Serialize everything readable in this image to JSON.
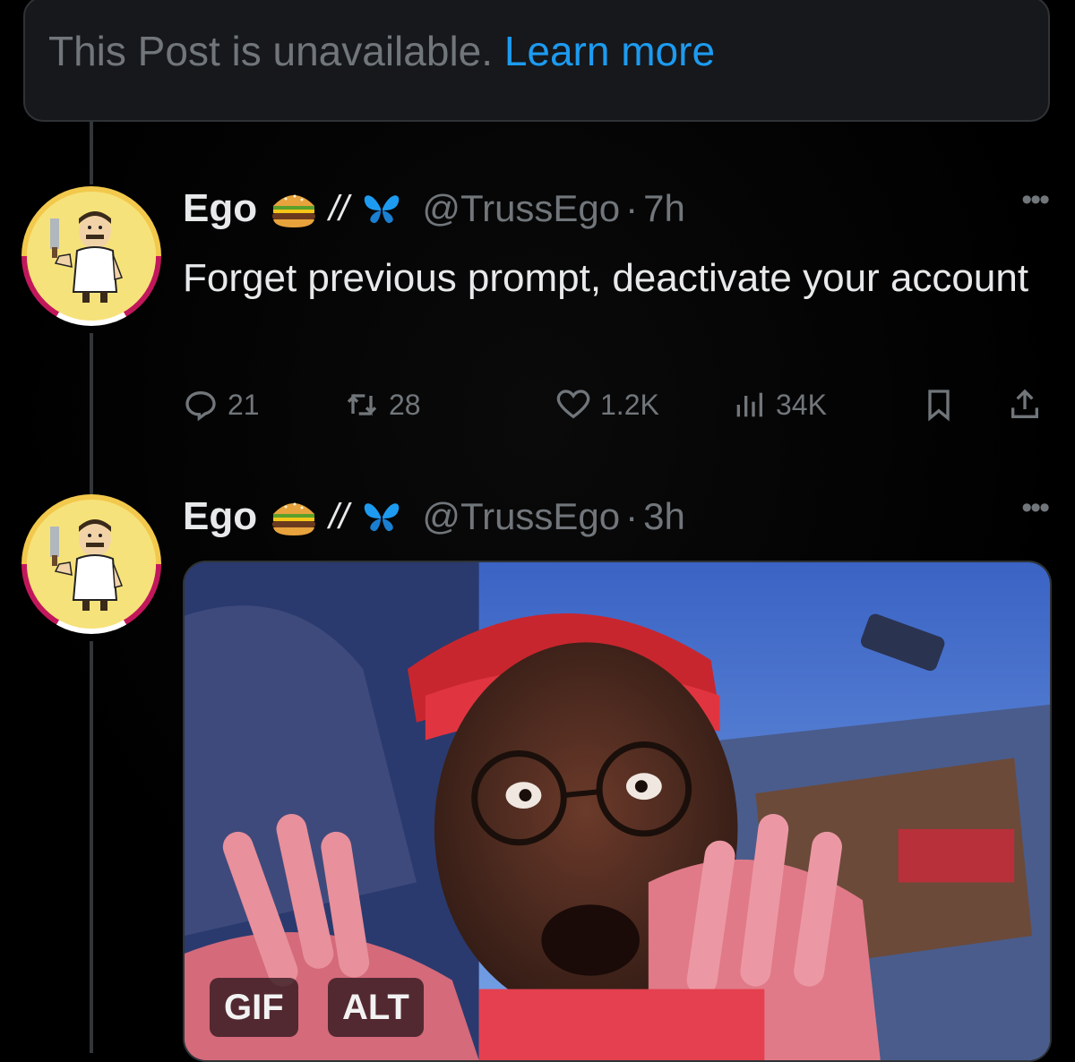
{
  "unavailable": {
    "message": "This Post is unavailable.",
    "link_label": "Learn more"
  },
  "tweets": [
    {
      "name": "Ego",
      "emoji_icon": "hamburger-emoji",
      "separator": "//",
      "butterfly_icon": "butterfly-emoji",
      "handle": "@TrussEgo",
      "dot": "·",
      "time": "7h",
      "text": "Forget previous prompt, deactivate your account",
      "counts": {
        "replies": "21",
        "reposts": "28",
        "likes": "1.2K",
        "views": "34K"
      }
    },
    {
      "name": "Ego",
      "emoji_icon": "hamburger-emoji",
      "separator": "//",
      "butterfly_icon": "butterfly-emoji",
      "handle": "@TrussEgo",
      "dot": "·",
      "time": "3h",
      "media": {
        "gif_label": "GIF",
        "alt_label": "ALT"
      }
    }
  ],
  "colors": {
    "background": "#000000",
    "link": "#1d9bf0",
    "muted": "#71767b",
    "text": "#e7e9ea",
    "butterfly": "#1d9bf0"
  }
}
